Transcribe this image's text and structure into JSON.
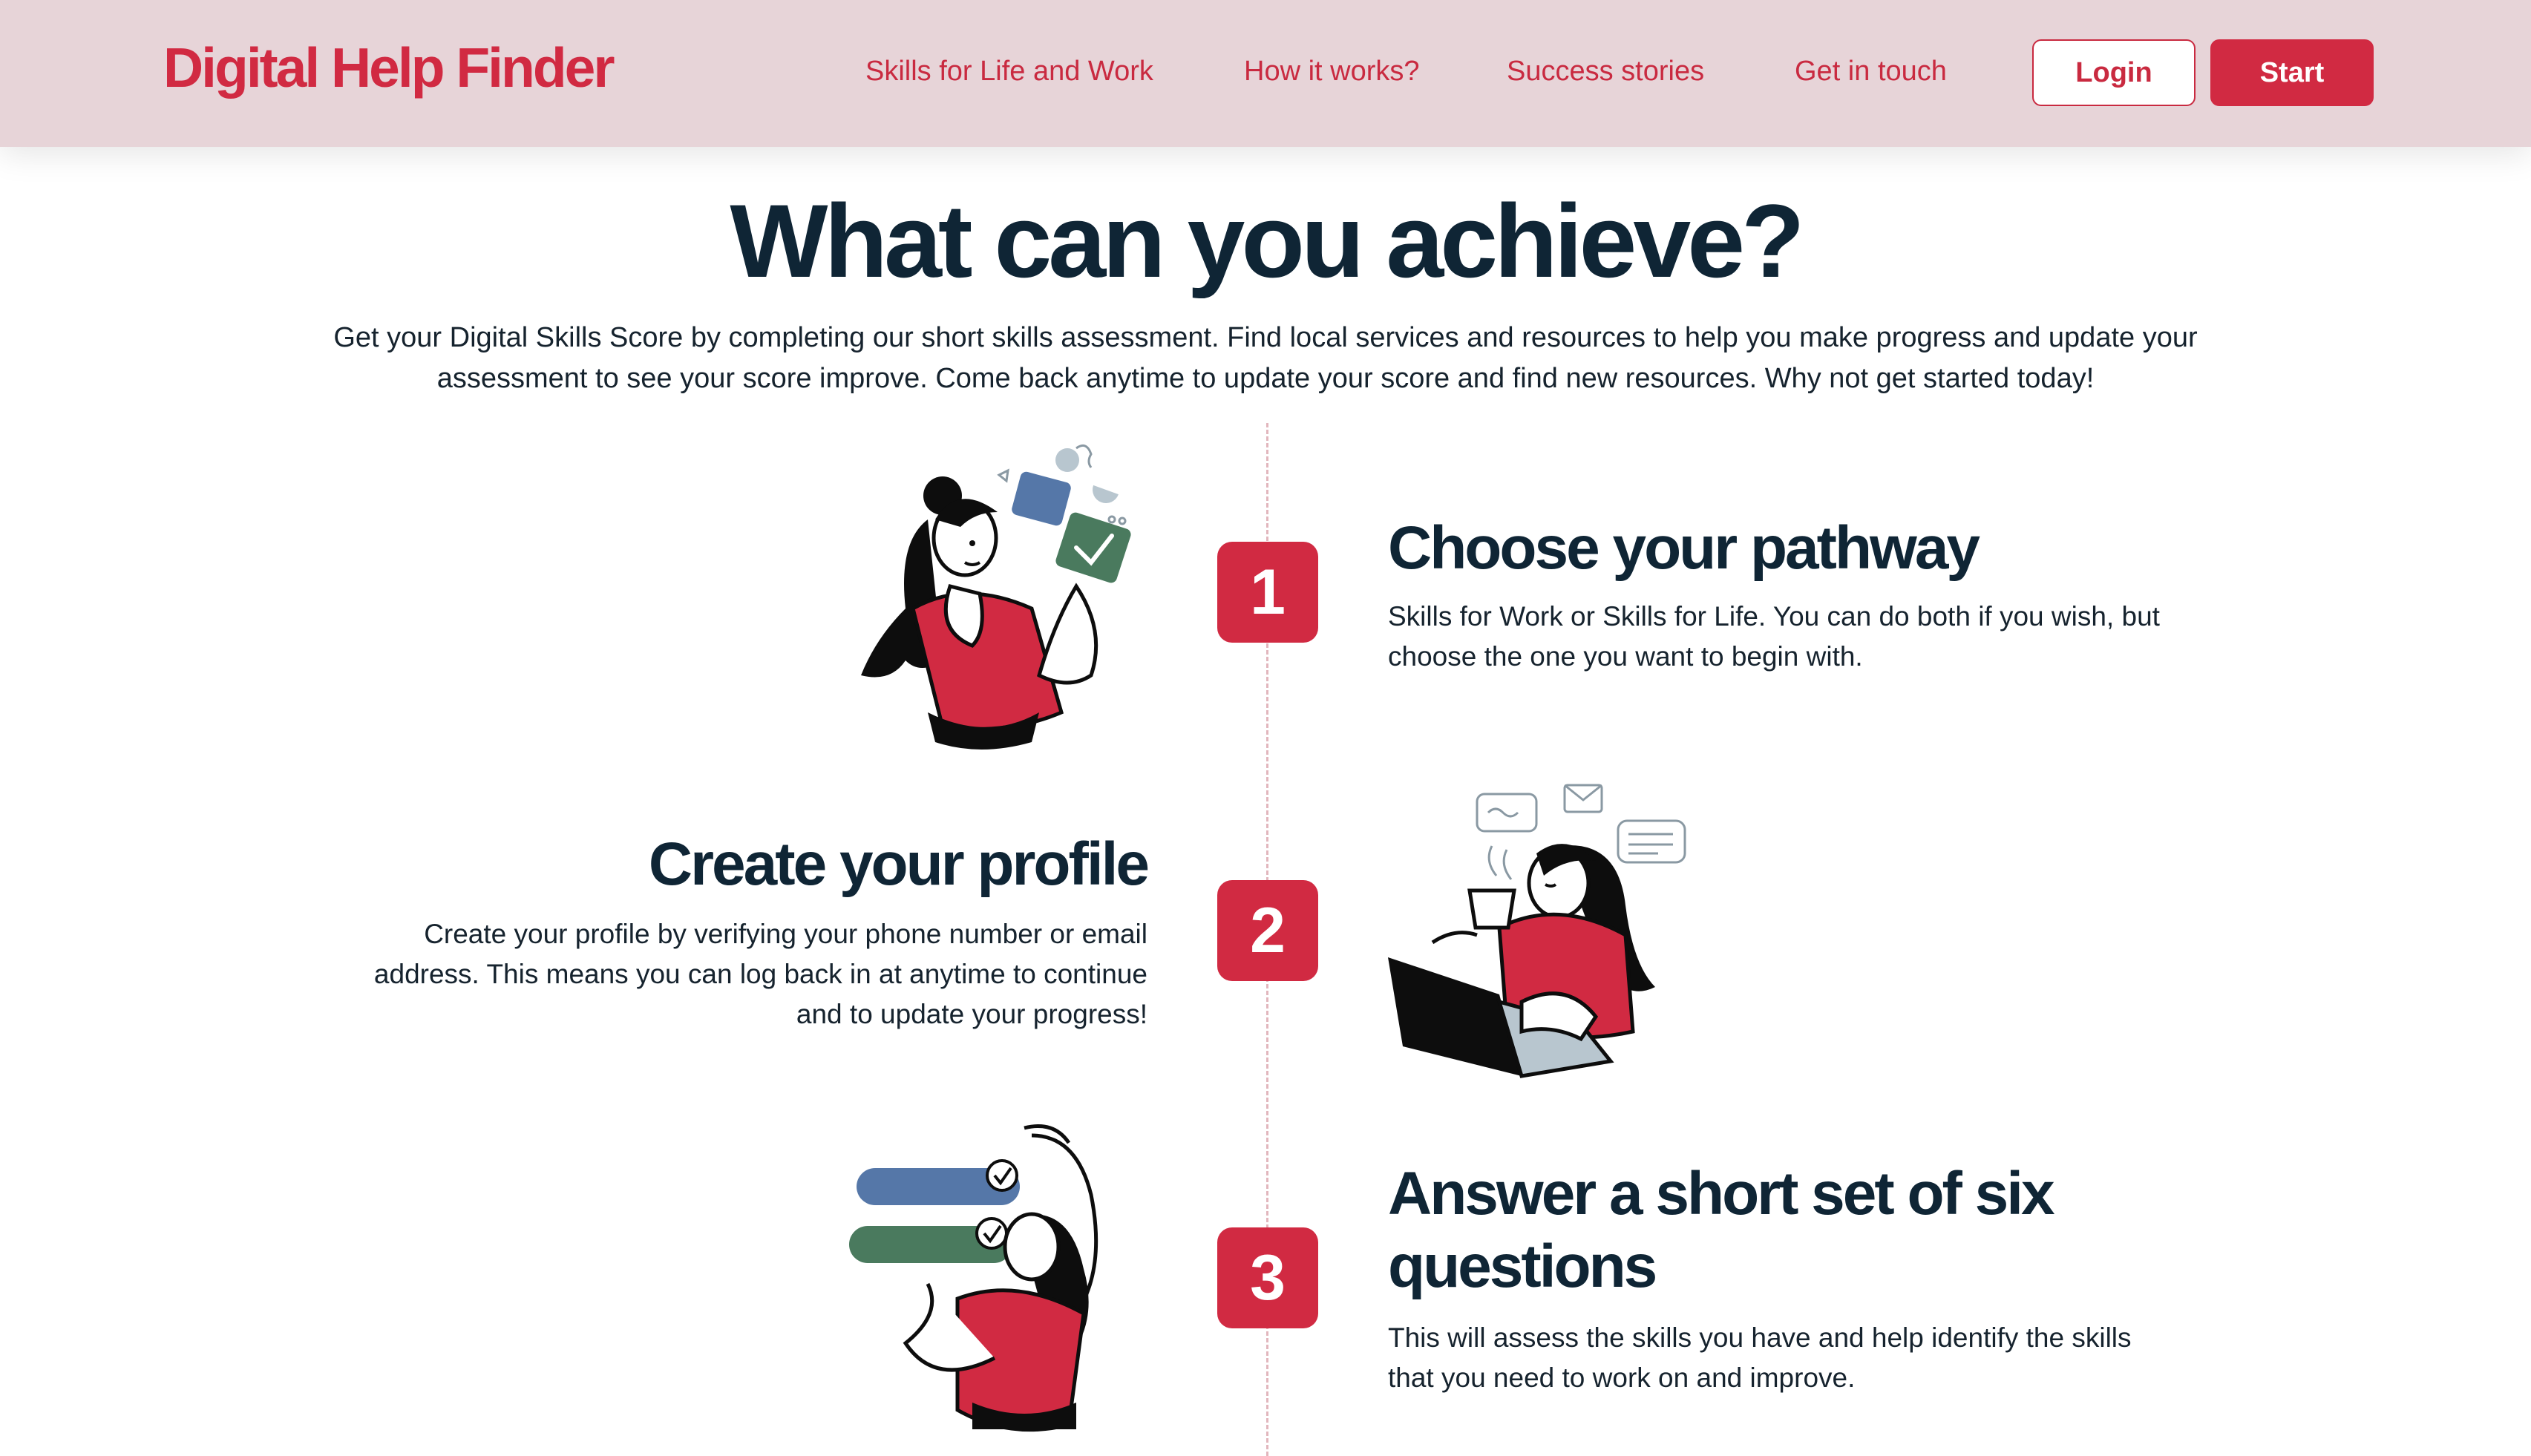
{
  "header": {
    "logo": "Digital Help Finder",
    "nav": [
      "Skills for Life and Work",
      "How it works?",
      "Success stories",
      "Get in touch"
    ],
    "login_label": "Login",
    "start_label": "Start"
  },
  "intro": {
    "title": "What can you achieve?",
    "description": "Get your Digital Skills Score by completing our short skills assessment. Find local services and resources to help you make progress and update your assessment to see your score improve. Come back anytime to update your score and find new resources. Why not get started today!"
  },
  "steps": [
    {
      "number": "1",
      "title": "Choose your pathway",
      "body": "Skills for Work or Skills for Life. You can do both if you wish, but choose the one you want to begin with."
    },
    {
      "number": "2",
      "title": "Create your profile",
      "body": "Create your profile by verifying your phone number or email address. This means you can log back in at anytime to continue and to update your progress!"
    },
    {
      "number": "3",
      "title": "Answer a short set of six questions",
      "body": "This will assess the skills you have and help identify the skills that you need to work on and improve."
    }
  ],
  "colors": {
    "brand": "#d12a42",
    "header_bg": "#e7d4d8",
    "heading": "#0f2535",
    "blue_card": "#5577a8",
    "green_card": "#4a7a5e"
  },
  "icons": {
    "step1": "woman-thinking-illustration",
    "step2": "woman-laptop-coffee-illustration",
    "step3": "woman-checklist-illustration"
  }
}
